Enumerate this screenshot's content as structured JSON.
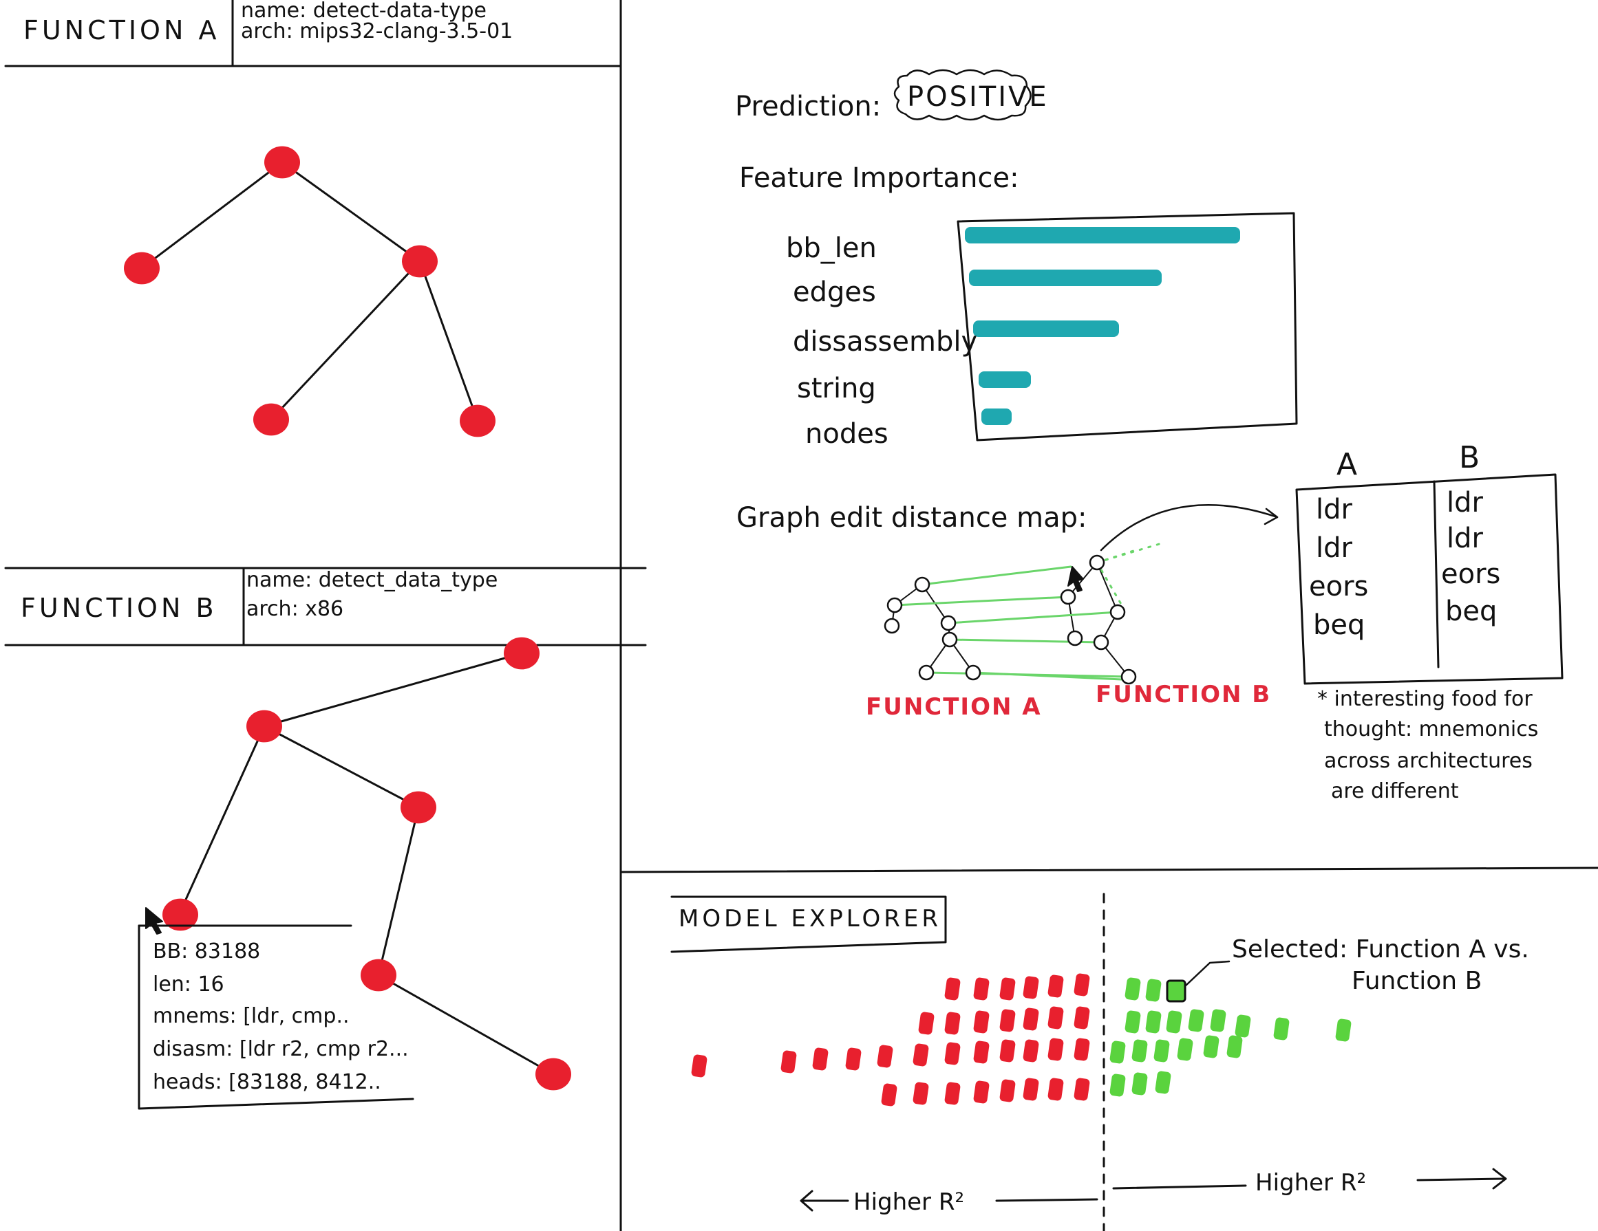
{
  "function_a": {
    "title": "FUNCTION A",
    "name": "name: detect-data-type",
    "arch": "arch: mips32-clang-3.5-01"
  },
  "function_b": {
    "title": "FUNCTION B",
    "name": "name: detect_data_type",
    "arch": "arch: x86"
  },
  "tooltip": {
    "bb": "BB: 83188",
    "len": "len: 16",
    "mnems": "mnems: [ldr, cmp..",
    "disasm": "disasm: [ldr r2, cmp r2...",
    "heads": "heads: [83188, 8412.."
  },
  "prediction": {
    "label": "Prediction:",
    "value": "POSITIVE"
  },
  "feature_importance": {
    "label": "Feature Importance:",
    "features": [
      "bb_len",
      "edges",
      "dissassembly",
      "string",
      "nodes"
    ],
    "values": [
      1.0,
      0.7,
      0.53,
      0.19,
      0.11
    ],
    "bar_color": "#1fa8b0"
  },
  "ged_map": {
    "label": "Graph edit distance map:",
    "function_a_label": "FUNCTION A",
    "function_b_label": "FUNCTION B",
    "link_color": "#6ad56a"
  },
  "mnemonic_table": {
    "col_a_header": "A",
    "col_b_header": "B",
    "col_a": [
      "ldr",
      "ldr",
      "eors",
      "beq"
    ],
    "col_b": [
      "ldr",
      "ldr",
      "eors",
      "beq"
    ],
    "note": [
      "* interesting food for",
      "thought: mnemonics",
      "across architectures",
      "are different"
    ]
  },
  "model_explorer": {
    "title": "MODEL EXPLORER",
    "selected_line1": "Selected: Function A vs.",
    "selected_line2": "Function B",
    "left_axis": "Higher R²",
    "right_axis": "Higher R²",
    "negative_color": "#e8202e",
    "positive_color": "#5ad33e"
  },
  "colors": {
    "node_red": "#e8202e",
    "ink": "#111111"
  }
}
